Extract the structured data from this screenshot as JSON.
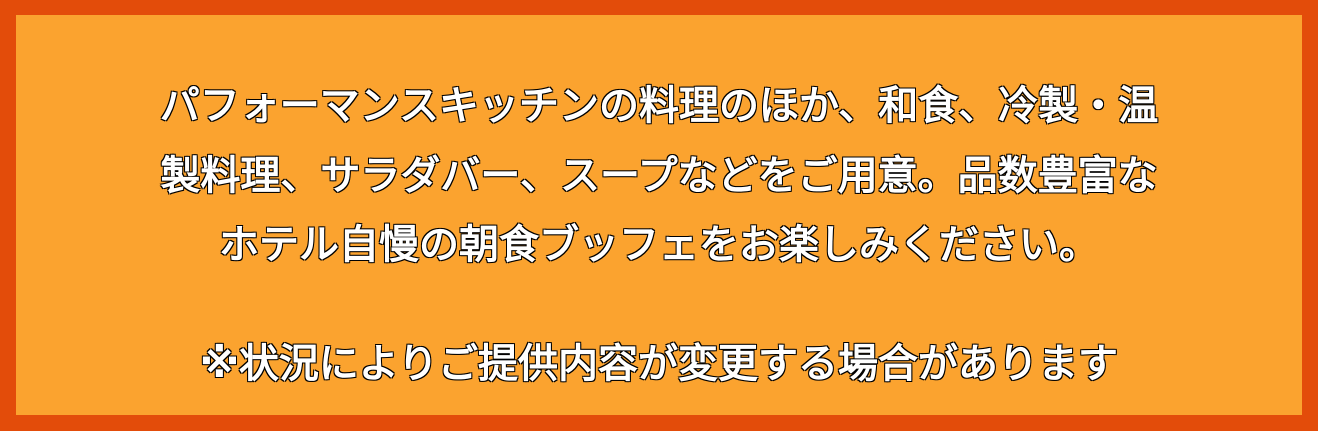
{
  "description_lines": [
    "パフォーマンスキッチンの料理のほか、和食、冷製・温",
    "製料理、サラダバー、スープなどをご用意。品数豊富な",
    "ホテル自慢の朝食ブッフェをお楽しみください。"
  ],
  "note": "※状況によりご提供内容が変更する場合があります",
  "colors": {
    "border": "#e34c0a",
    "panel": "#fba32f",
    "text": "#ffffff"
  }
}
